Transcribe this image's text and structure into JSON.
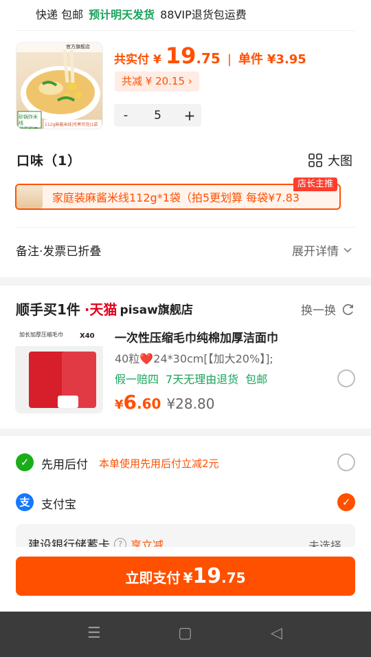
{
  "shipping": {
    "method": "快递 包邮",
    "eta": "预计明天发货",
    "vip": "88VIP退货包运费"
  },
  "product": {
    "thumb_caption_left": "砂锅炸米线\n可煮可泡",
    "thumb_caption_bottom": "112g麻酱米线|可煮可泡|1袋",
    "thumb_brand": "官方旗舰店",
    "total_label": "共实付",
    "currency": "¥",
    "total_int": "19",
    "total_dec": ".75",
    "unit_label": "单件",
    "unit_price": "¥3.95",
    "discount": "共减 ¥ 20.15 ›",
    "quantity": "5",
    "minus": "-",
    "plus": "+"
  },
  "flavor": {
    "label": "口味（1）",
    "bigpic": "大图",
    "variant": "家庭装麻酱米线112g*1袋（拍5更划算  每袋¥7.83",
    "badge": "店长主推"
  },
  "remark": {
    "label": "备注·发票已折叠",
    "expand": "展开详情"
  },
  "addon": {
    "title": "顺手买1件",
    "tmall": "·天猫",
    "store": "pisaw旗舰店",
    "refresh": "换一换",
    "name": "一次性压缩毛巾纯棉加厚洁面巾",
    "spec": "40粒❤️24*30cm[【加大20%】];",
    "tags": [
      "假一赔四",
      "7天无理由退货",
      "包邮"
    ],
    "currency": "¥",
    "price_int": "6",
    "price_dec": ".60",
    "orig": "¥28.80",
    "img_header": "加长加厚压缩毛巾",
    "img_count": "X40"
  },
  "payment": {
    "options": [
      {
        "name": "先用后付",
        "note": "本单使用先用后付立减2元",
        "checked": false
      },
      {
        "name": "支付宝",
        "note": "",
        "checked": true
      }
    ],
    "card": {
      "name": "建设银行储蓄卡",
      "discount": "享立减",
      "state": "未选择"
    }
  },
  "pay_button": {
    "label": "立即支付",
    "currency": "¥",
    "int": "19",
    "dec": ".75"
  },
  "nav": {
    "menu": "☰",
    "home": "▢",
    "back": "◁"
  },
  "colors": {
    "accent": "#ff5000",
    "green": "#1aa35b",
    "tmall": "#e3001b"
  }
}
